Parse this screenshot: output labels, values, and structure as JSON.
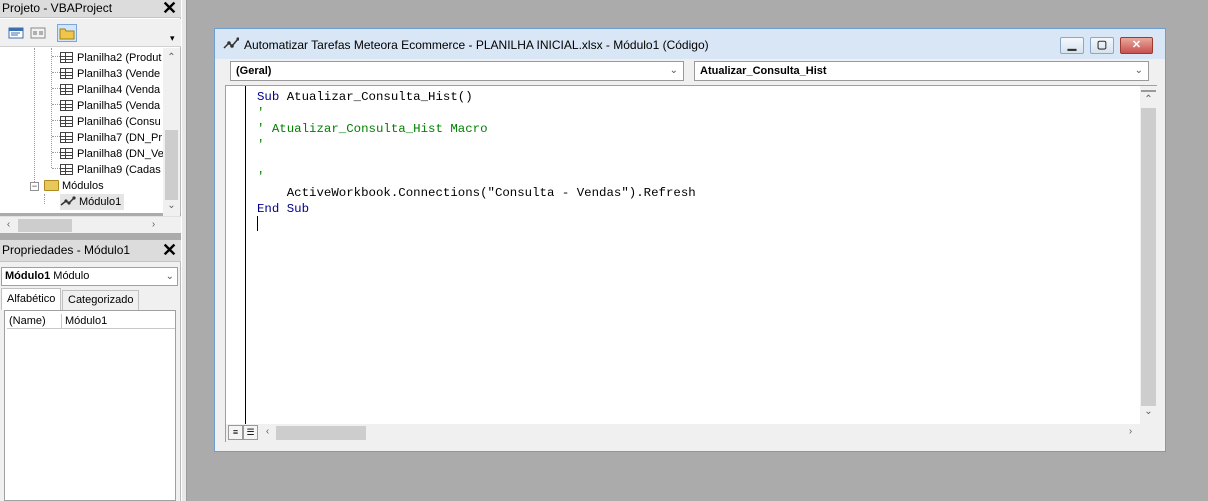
{
  "project": {
    "title": "Projeto - VBAProject",
    "close": "✕",
    "items": [
      {
        "label": "Planilha2 (Produt"
      },
      {
        "label": "Planilha3 (Vende"
      },
      {
        "label": "Planilha4 (Venda"
      },
      {
        "label": "Planilha5 (Venda"
      },
      {
        "label": "Planilha6 (Consu"
      },
      {
        "label": "Planilha7 (DN_Pr"
      },
      {
        "label": "Planilha8 (DN_Ve"
      },
      {
        "label": "Planilha9 (Cadas"
      }
    ],
    "folder": "Módulos",
    "module": "Módulo1"
  },
  "properties": {
    "title": "Propriedades - Módulo1",
    "close": "✕",
    "object_name": "Módulo1",
    "object_type": "Módulo",
    "tabs": [
      "Alfabético",
      "Categorizado"
    ],
    "rows": [
      {
        "key": "(Name)",
        "value": "Módulo1"
      }
    ]
  },
  "code_window": {
    "title": "Automatizar Tarefas Meteora Ecommerce - PLANILHA INICIAL.xlsx - Módulo1 (Código)",
    "object_combo": "(Geral)",
    "proc_combo": "Atualizar_Consulta_Hist",
    "lines": {
      "l1_kw1": "Sub",
      "l1_rest": " Atualizar_Consulta_Hist()",
      "l2": "'",
      "l3": "' Atualizar_Consulta_Hist Macro",
      "l4": "'",
      "l5": "",
      "l6": "'",
      "l7": "    ActiveWorkbook.Connections(\"Consulta - Vendas\").Refresh",
      "l8_kw": "End Sub"
    }
  },
  "colors": {
    "keyword": "#00008b",
    "comment": "#008000",
    "background": "#ababab"
  }
}
